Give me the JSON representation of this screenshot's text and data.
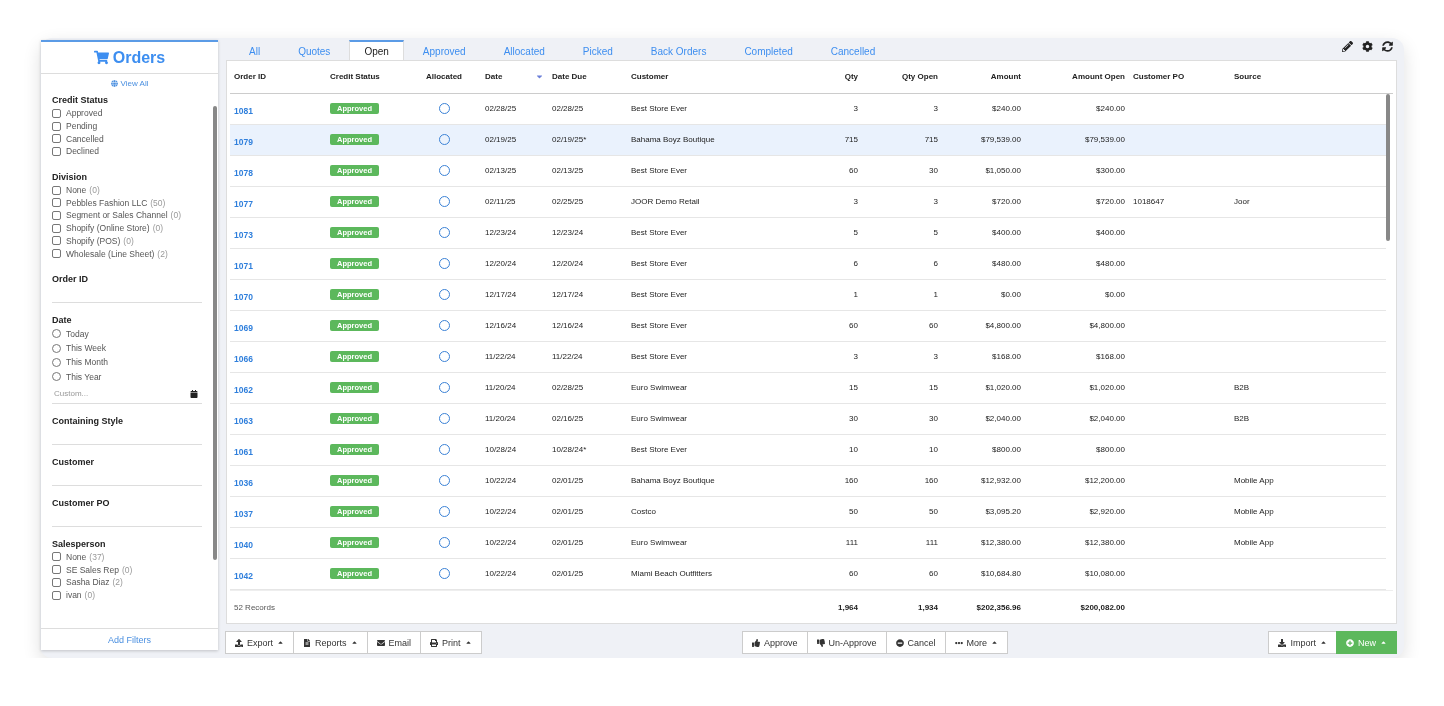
{
  "sidebar": {
    "title": "Orders",
    "view_all": "View All",
    "filters": [
      {
        "kind": "checkbox_list",
        "title": "Credit Status",
        "options": [
          {
            "label": "Approved",
            "checked": false
          },
          {
            "label": "Pending",
            "checked": false
          },
          {
            "label": "Cancelled",
            "checked": false
          },
          {
            "label": "Declined",
            "checked": false
          }
        ]
      },
      {
        "kind": "checkbox_list",
        "title": "Division",
        "options": [
          {
            "label": "None",
            "count": "(0)",
            "checked": false
          },
          {
            "label": "Pebbles Fashion LLC",
            "count": "(50)",
            "checked": false
          },
          {
            "label": "Segment or Sales Channel",
            "count": "(0)",
            "checked": false
          },
          {
            "label": "Shopify (Online Store)",
            "count": "(0)",
            "checked": false
          },
          {
            "label": "Shopify (POS)",
            "count": "(0)",
            "checked": false
          },
          {
            "label": "Wholesale (Line Sheet)",
            "count": "(2)",
            "checked": false
          }
        ]
      },
      {
        "kind": "text",
        "title": "Order ID"
      },
      {
        "kind": "radio_list",
        "title": "Date",
        "options": [
          {
            "label": "Today",
            "selected": false
          },
          {
            "label": "This Week",
            "selected": false
          },
          {
            "label": "This Month",
            "selected": false
          },
          {
            "label": "This Year",
            "selected": false
          }
        ],
        "placeholder": "Custom..."
      },
      {
        "kind": "text",
        "title": "Containing Style"
      },
      {
        "kind": "text",
        "title": "Customer"
      },
      {
        "kind": "text",
        "title": "Customer PO"
      },
      {
        "kind": "checkbox_list",
        "title": "Salesperson",
        "options": [
          {
            "label": "None",
            "count": "(37)",
            "checked": false
          },
          {
            "label": "SE Sales Rep",
            "count": "(0)",
            "checked": false
          },
          {
            "label": "Sasha Diaz",
            "count": "(2)",
            "checked": false
          },
          {
            "label": "ivan",
            "count": "(0)",
            "checked": false
          }
        ]
      }
    ],
    "add_filters": "Add Filters"
  },
  "tabs": [
    {
      "label": "All",
      "selected": false
    },
    {
      "label": "Quotes",
      "selected": false
    },
    {
      "label": "Open",
      "selected": true
    },
    {
      "label": "Approved",
      "selected": false
    },
    {
      "label": "Allocated",
      "selected": false
    },
    {
      "label": "Picked",
      "selected": false
    },
    {
      "label": "Back Orders",
      "selected": false
    },
    {
      "label": "Completed",
      "selected": false
    },
    {
      "label": "Cancelled",
      "selected": false
    }
  ],
  "table": {
    "columns": [
      {
        "label": "Order ID",
        "sorted": false
      },
      {
        "label": "Credit Status",
        "sorted": false
      },
      {
        "label": "Allocated",
        "sorted": false
      },
      {
        "label": "Date",
        "sorted": true
      },
      {
        "label": "Date Due",
        "sorted": false
      },
      {
        "label": "Customer",
        "sorted": false
      },
      {
        "label": "Qty",
        "sorted": false
      },
      {
        "label": "Qty Open",
        "sorted": false
      },
      {
        "label": "Amount",
        "sorted": false
      },
      {
        "label": "Amount Open",
        "sorted": false
      },
      {
        "label": "Customer PO",
        "sorted": false
      },
      {
        "label": "Source",
        "sorted": false
      }
    ],
    "rows": [
      {
        "id": "1081",
        "credit": "Approved",
        "allocated": false,
        "date": "02/28/25",
        "due": "02/28/25",
        "customer": "Best Store Ever",
        "qty": "3",
        "qty_open": "3",
        "amount": "$240.00",
        "amount_open": "$240.00",
        "selected": false
      },
      {
        "id": "1079",
        "credit": "Approved",
        "allocated": false,
        "date": "02/19/25",
        "due": "02/19/25*",
        "customer": "Bahama Boyz Boutique",
        "qty": "715",
        "qty_open": "715",
        "amount": "$79,539.00",
        "amount_open": "$79,539.00",
        "selected": true
      },
      {
        "id": "1078",
        "credit": "Approved",
        "allocated": false,
        "date": "02/13/25",
        "due": "02/13/25",
        "customer": "Best Store Ever",
        "qty": "60",
        "qty_open": "30",
        "amount": "$1,050.00",
        "amount_open": "$300.00",
        "selected": false
      },
      {
        "id": "1077",
        "credit": "Approved",
        "allocated": false,
        "date": "02/11/25",
        "due": "02/25/25",
        "customer": "JOOR Demo Retail",
        "qty": "3",
        "qty_open": "3",
        "amount": "$720.00",
        "amount_open": "$720.00",
        "customer_po": "1018647",
        "source": "Joor",
        "selected": false
      },
      {
        "id": "1073",
        "credit": "Approved",
        "allocated": false,
        "date": "12/23/24",
        "due": "12/23/24",
        "customer": "Best Store Ever",
        "qty": "5",
        "qty_open": "5",
        "amount": "$400.00",
        "amount_open": "$400.00",
        "selected": false
      },
      {
        "id": "1071",
        "credit": "Approved",
        "allocated": false,
        "date": "12/20/24",
        "due": "12/20/24",
        "customer": "Best Store Ever",
        "qty": "6",
        "qty_open": "6",
        "amount": "$480.00",
        "amount_open": "$480.00",
        "selected": false
      },
      {
        "id": "1070",
        "credit": "Approved",
        "allocated": false,
        "date": "12/17/24",
        "due": "12/17/24",
        "customer": "Best Store Ever",
        "qty": "1",
        "qty_open": "1",
        "amount": "$0.00",
        "amount_open": "$0.00",
        "selected": false
      },
      {
        "id": "1069",
        "credit": "Approved",
        "allocated": false,
        "date": "12/16/24",
        "due": "12/16/24",
        "customer": "Best Store Ever",
        "qty": "60",
        "qty_open": "60",
        "amount": "$4,800.00",
        "amount_open": "$4,800.00",
        "selected": false
      },
      {
        "id": "1066",
        "credit": "Approved",
        "allocated": false,
        "date": "11/22/24",
        "due": "11/22/24",
        "customer": "Best Store Ever",
        "qty": "3",
        "qty_open": "3",
        "amount": "$168.00",
        "amount_open": "$168.00",
        "selected": false
      },
      {
        "id": "1062",
        "credit": "Approved",
        "allocated": false,
        "date": "11/20/24",
        "due": "02/28/25",
        "customer": "Euro Swimwear",
        "qty": "15",
        "qty_open": "15",
        "amount": "$1,020.00",
        "amount_open": "$1,020.00",
        "source": "B2B",
        "selected": false
      },
      {
        "id": "1063",
        "credit": "Approved",
        "allocated": false,
        "date": "11/20/24",
        "due": "02/16/25",
        "customer": "Euro Swimwear",
        "qty": "30",
        "qty_open": "30",
        "amount": "$2,040.00",
        "amount_open": "$2,040.00",
        "source": "B2B",
        "selected": false
      },
      {
        "id": "1061",
        "credit": "Approved",
        "allocated": false,
        "date": "10/28/24",
        "due": "10/28/24*",
        "customer": "Best Store Ever",
        "qty": "10",
        "qty_open": "10",
        "amount": "$800.00",
        "amount_open": "$800.00",
        "selected": false
      },
      {
        "id": "1036",
        "credit": "Approved",
        "allocated": false,
        "date": "10/22/24",
        "due": "02/01/25",
        "customer": "Bahama Boyz Boutique",
        "qty": "160",
        "qty_open": "160",
        "amount": "$12,932.00",
        "amount_open": "$12,200.00",
        "source": "Mobile App",
        "selected": false
      },
      {
        "id": "1037",
        "credit": "Approved",
        "allocated": false,
        "date": "10/22/24",
        "due": "02/01/25",
        "customer": "Costco",
        "qty": "50",
        "qty_open": "50",
        "amount": "$3,095.20",
        "amount_open": "$2,920.00",
        "source": "Mobile App",
        "selected": false
      },
      {
        "id": "1040",
        "credit": "Approved",
        "allocated": false,
        "date": "10/22/24",
        "due": "02/01/25",
        "customer": "Euro Swimwear",
        "qty": "111",
        "qty_open": "111",
        "amount": "$12,380.00",
        "amount_open": "$12,380.00",
        "source": "Mobile App",
        "selected": false
      },
      {
        "id": "1042",
        "credit": "Approved",
        "allocated": false,
        "date": "10/22/24",
        "due": "02/01/25",
        "customer": "Miami Beach Outfitters",
        "qty": "60",
        "qty_open": "60",
        "amount": "$10,684.80",
        "amount_open": "$10,080.00",
        "selected": false
      }
    ],
    "footer": {
      "records": "52 Records",
      "qty": "1,964",
      "qty_open": "1,934",
      "amount": "$202,356.96",
      "amount_open": "$200,082.00"
    }
  },
  "toolbar": {
    "left": [
      {
        "kind": "export",
        "label": "Export",
        "menu": true
      },
      {
        "kind": "reports",
        "label": "Reports",
        "menu": true
      },
      {
        "kind": "email",
        "label": "Email",
        "menu": false
      },
      {
        "kind": "print",
        "label": "Print",
        "menu": true
      }
    ],
    "center": [
      {
        "kind": "approve",
        "label": "Approve",
        "menu": false
      },
      {
        "kind": "unapprove",
        "label": "Un-Approve",
        "menu": false
      },
      {
        "kind": "cancel",
        "label": "Cancel",
        "menu": false
      },
      {
        "kind": "more",
        "label": "More",
        "menu": true
      }
    ],
    "right": [
      {
        "kind": "import",
        "label": "Import",
        "menu": true
      },
      {
        "kind": "new",
        "label": "New",
        "menu": true
      }
    ]
  }
}
